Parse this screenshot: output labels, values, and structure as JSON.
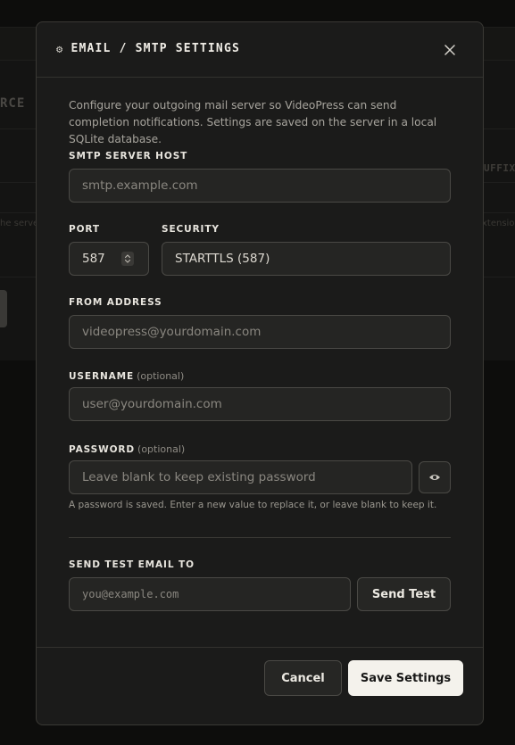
{
  "background": {
    "heading_fragment": "RCE",
    "column_fragment": "UFFIX",
    "row_left_fragment": "he serve",
    "row_right_fragment": "xtensio"
  },
  "modal": {
    "title": "EMAIL / SMTP SETTINGS",
    "gear_icon": "⚙",
    "intro": "Configure your outgoing mail server so VideoPress can send completion notifications. Settings are saved on the server in a local SQLite database."
  },
  "fields": {
    "host": {
      "label": "SMTP SERVER HOST",
      "placeholder": "smtp.example.com",
      "value": ""
    },
    "port": {
      "label": "PORT",
      "value": "587"
    },
    "security": {
      "label": "SECURITY",
      "value": "STARTTLS (587)"
    },
    "from": {
      "label": "FROM ADDRESS",
      "placeholder": "videopress@yourdomain.com",
      "value": ""
    },
    "username": {
      "label": "USERNAME",
      "optional": "(optional)",
      "placeholder": "user@yourdomain.com",
      "value": ""
    },
    "password": {
      "label": "PASSWORD",
      "optional": "(optional)",
      "placeholder": "Leave blank to keep existing password",
      "value": "",
      "help": "A password is saved. Enter a new value to replace it, or leave blank to keep it."
    },
    "test": {
      "label": "SEND TEST EMAIL TO",
      "placeholder": "you@example.com",
      "value": ""
    }
  },
  "buttons": {
    "send_test": "Send Test",
    "cancel": "Cancel",
    "save": "Save Settings"
  },
  "colors": {
    "surface": "#1b1b1a",
    "input_bg": "#252523",
    "border": "#4a4945",
    "primary_bg": "#f4f2ec",
    "primary_text": "#171716"
  }
}
